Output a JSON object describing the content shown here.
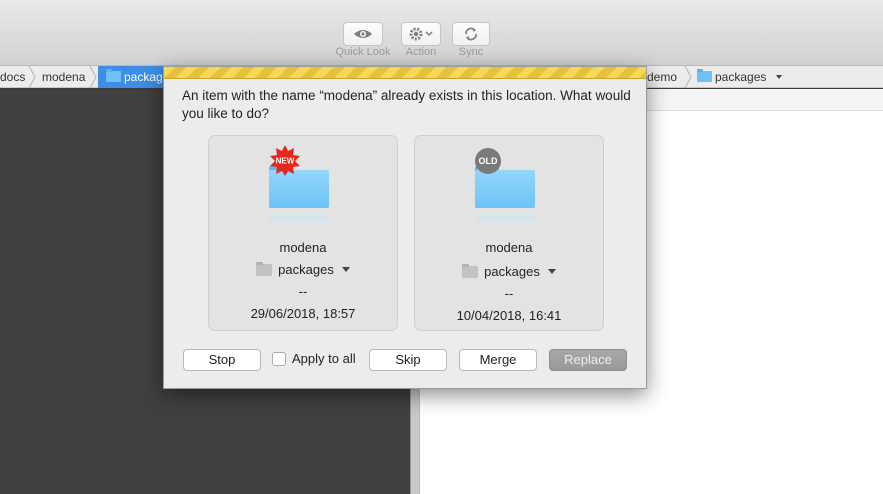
{
  "toolbar": {
    "quick_look": {
      "label": "Quick Look",
      "icon": "eye-icon"
    },
    "action": {
      "label": "Action",
      "icon": "gear-icon"
    },
    "sync": {
      "label": "Sync",
      "icon": "sync-icon"
    }
  },
  "left_path": {
    "items": [
      "docs",
      "modena",
      "packag"
    ]
  },
  "right_path": {
    "items": [
      "demo",
      "packages"
    ]
  },
  "dialog": {
    "message": "An item with the name “modena” already exists in this location. What would you like to do?",
    "new_item": {
      "badge": "NEW",
      "name": "modena",
      "location": "packages",
      "size": "--",
      "date": "29/06/2018, 18:57"
    },
    "old_item": {
      "badge": "OLD",
      "name": "modena",
      "location": "packages",
      "size": "--",
      "date": "10/04/2018, 16:41"
    },
    "buttons": {
      "stop": "Stop",
      "apply_to_all": "Apply to all",
      "skip": "Skip",
      "merge": "Merge",
      "replace": "Replace"
    }
  },
  "colors": {
    "stripe": "#f4d85a",
    "folder": "#6cc4f6",
    "selected_crumb": "#3d8ee8",
    "new_badge": "#e8261c"
  }
}
